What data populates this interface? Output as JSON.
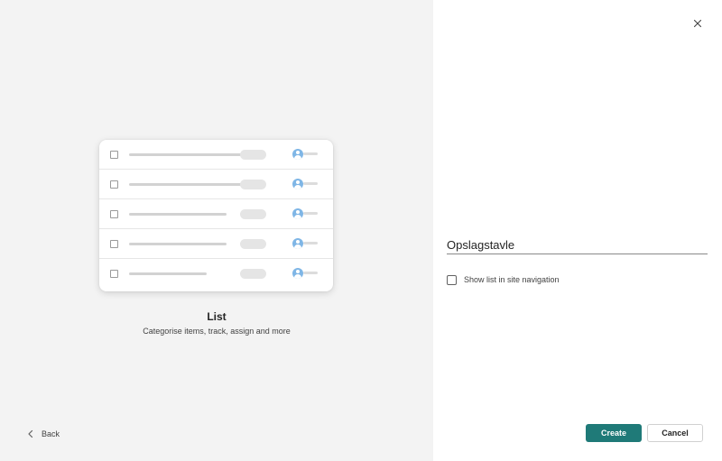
{
  "template": {
    "title": "List",
    "description": "Categorise items, track, assign and more",
    "preview_icon": "list-preview-illustration"
  },
  "navigation": {
    "back_label": "Back",
    "back_icon": "chevron-left-icon",
    "close_icon": "close-icon"
  },
  "form": {
    "name_value": "Opslagstavle",
    "show_in_nav_label": "Show list in site navigation",
    "show_in_nav_checked": false
  },
  "actions": {
    "create_label": "Create",
    "cancel_label": "Cancel"
  },
  "colors": {
    "primary": "#1f7a78",
    "left_pane_bg": "#f3f3f3",
    "avatar": "#7fb6e6"
  }
}
